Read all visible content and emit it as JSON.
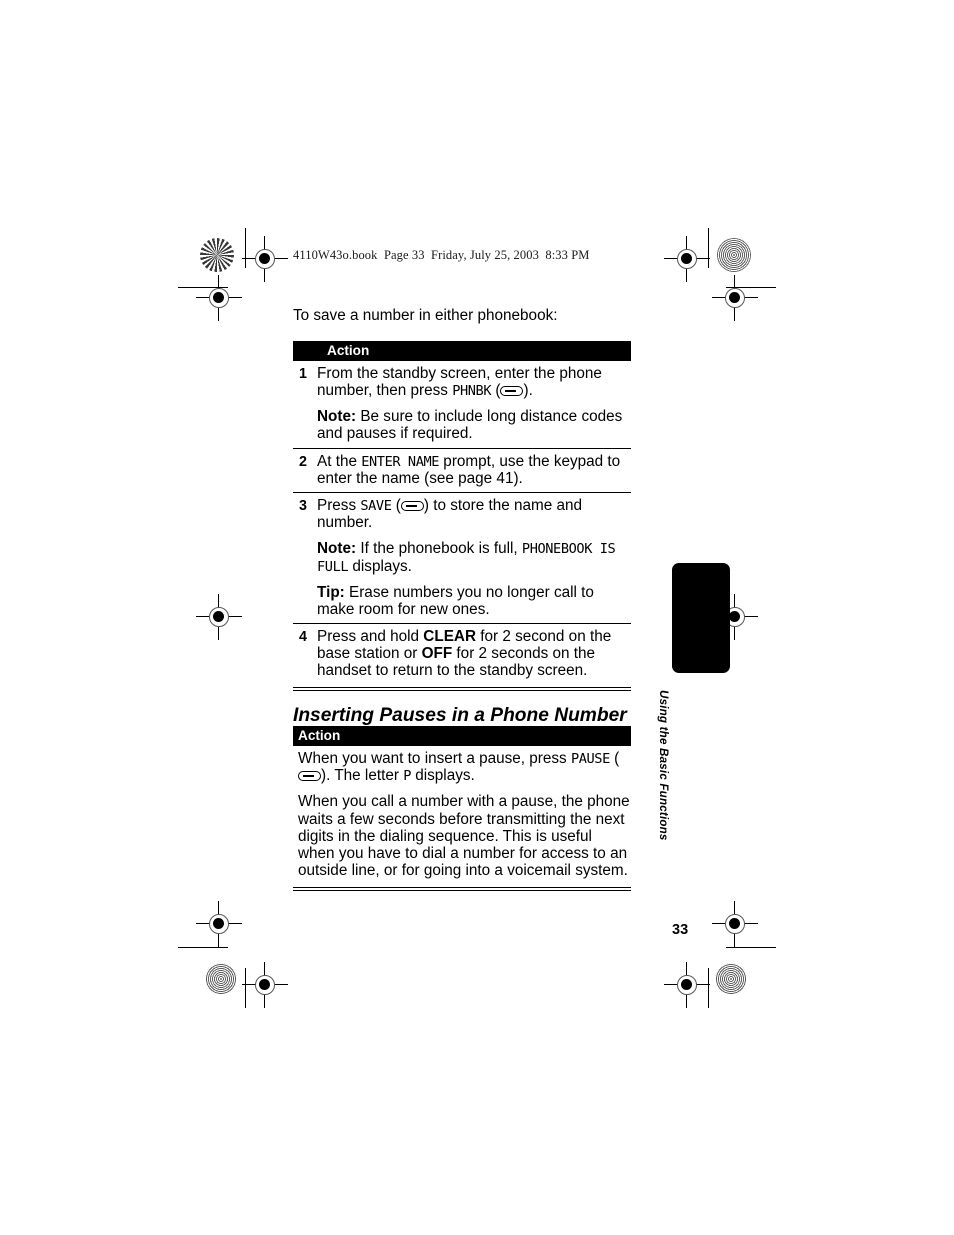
{
  "book_header": "4110W43o.book  Page 33  Friday, July 25, 2003  8:33 PM",
  "intro": "To save a number in either phonebook:",
  "table1": {
    "header": "Action",
    "rows": [
      {
        "num": "1",
        "paras": [
          {
            "lead": "",
            "pre": "From the standby screen, enter the phone number, then press ",
            "lcd": "PHNBK",
            "mid": " (",
            "softkey": true,
            "post": ")."
          },
          {
            "lead": "Note:",
            "pre": " Be sure to include long distance codes and pauses if required.",
            "lcd": "",
            "mid": "",
            "softkey": false,
            "post": ""
          }
        ]
      },
      {
        "num": "2",
        "paras": [
          {
            "lead": "",
            "pre": "At the ",
            "lcd": "ENTER NAME",
            "mid": " prompt, use the keypad to enter the name (see page 41).",
            "softkey": false,
            "post": ""
          }
        ]
      },
      {
        "num": "3",
        "paras": [
          {
            "lead": "",
            "pre": "Press ",
            "lcd": "SAVE",
            "mid": " (",
            "softkey": true,
            "post": ") to store the name and number."
          },
          {
            "lead": "Note:",
            "pre": " If the phonebook is full, ",
            "lcd": "PHONEBOOK IS FULL",
            "mid": " displays.",
            "softkey": false,
            "post": ""
          },
          {
            "lead": "Tip:",
            "pre": " Erase numbers you no longer call to make room for new ones.",
            "lcd": "",
            "mid": "",
            "softkey": false,
            "post": ""
          }
        ]
      },
      {
        "num": "4",
        "paras": [
          {
            "lead": "",
            "pre": "Press and hold ",
            "bold1": "CLEAR",
            "mid": " for 2 second on the base station or ",
            "bold2": "OFF",
            "post": " for 2 seconds on the handset to return to the standby screen."
          }
        ]
      }
    ]
  },
  "section_heading": "Inserting Pauses in a Phone Number",
  "table2": {
    "header": "Action",
    "paras": [
      {
        "pre": "When you want to insert a pause, press ",
        "lcd": "PAUSE",
        "mid": " (",
        "softkey": true,
        "post": "). The letter ",
        "lcd2": "P",
        "post2": " displays."
      },
      {
        "pre": "When you call a number with a pause, the phone waits a few seconds before transmitting the next digits in the dialing sequence. This is useful when you have to dial a number for access to an outside line, or for going into a voicemail system.",
        "lcd": "",
        "mid": "",
        "softkey": false,
        "post": ""
      }
    ]
  },
  "thumb_tab_label": "Using the Basic Functions",
  "page_number": "33"
}
